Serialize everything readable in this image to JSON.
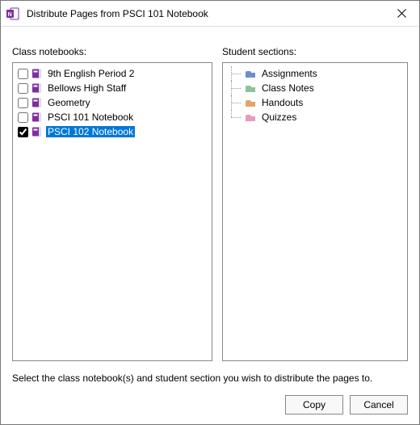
{
  "window": {
    "title": "Distribute Pages from PSCI 101 Notebook"
  },
  "labels": {
    "class_notebooks": "Class notebooks:",
    "student_sections": "Student sections:"
  },
  "class_notebooks": [
    {
      "label": "9th English  Period 2",
      "checked": false,
      "selected": false,
      "color": "#7b2fa0"
    },
    {
      "label": "Bellows High Staff",
      "checked": false,
      "selected": false,
      "color": "#7b2fa0"
    },
    {
      "label": "Geometry",
      "checked": false,
      "selected": false,
      "color": "#7b2fa0"
    },
    {
      "label": "PSCI 101 Notebook",
      "checked": false,
      "selected": false,
      "color": "#7b2fa0"
    },
    {
      "label": "PSCI 102 Notebook",
      "checked": true,
      "selected": true,
      "color": "#7b2fa0"
    }
  ],
  "student_sections": [
    {
      "label": "Assignments",
      "color": "#6b8ecf"
    },
    {
      "label": "Class Notes",
      "color": "#8bc29a"
    },
    {
      "label": "Handouts",
      "color": "#e3a36b"
    },
    {
      "label": "Quizzes",
      "color": "#e59bc0"
    }
  ],
  "footer": {
    "instruction": "Select the class notebook(s) and student section you wish to distribute the pages to.",
    "copy": "Copy",
    "cancel": "Cancel"
  }
}
